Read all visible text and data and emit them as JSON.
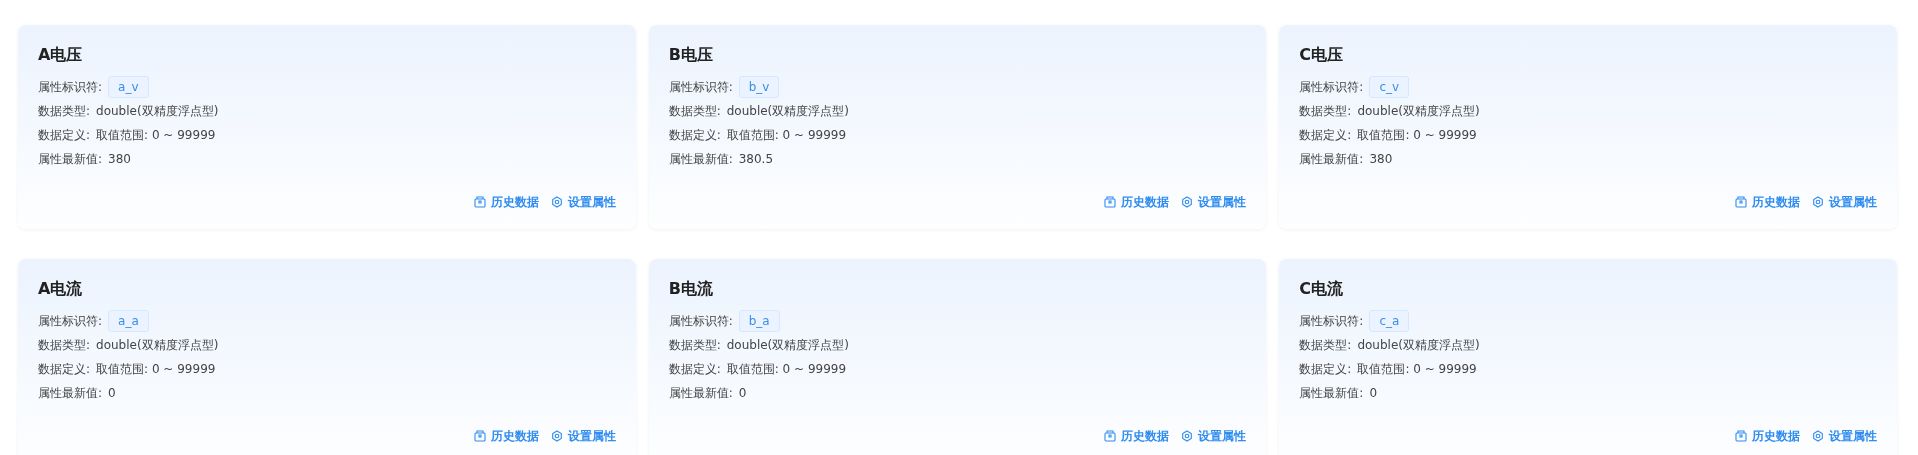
{
  "cards": [
    {
      "title": "A电压",
      "fields": [
        {
          "kind": "tag",
          "label": "属性标识符:",
          "value": "a_v"
        },
        {
          "kind": "text",
          "label": "数据类型:",
          "value": "double(双精度浮点型)"
        },
        {
          "kind": "text",
          "label": "数据定义:",
          "value": "取值范围: 0 ~ 99999"
        },
        {
          "kind": "text",
          "label": "属性最新值:",
          "value": "380"
        }
      ],
      "actions": [
        {
          "kind": "history",
          "label": "历史数据"
        },
        {
          "kind": "settings",
          "label": "设置属性"
        }
      ]
    },
    {
      "title": "B电压",
      "fields": [
        {
          "kind": "tag",
          "label": "属性标识符:",
          "value": "b_v"
        },
        {
          "kind": "text",
          "label": "数据类型:",
          "value": "double(双精度浮点型)"
        },
        {
          "kind": "text",
          "label": "数据定义:",
          "value": "取值范围: 0 ~ 99999"
        },
        {
          "kind": "text",
          "label": "属性最新值:",
          "value": "380.5"
        }
      ],
      "actions": [
        {
          "kind": "history",
          "label": "历史数据"
        },
        {
          "kind": "settings",
          "label": "设置属性"
        }
      ]
    },
    {
      "title": "C电压",
      "fields": [
        {
          "kind": "tag",
          "label": "属性标识符:",
          "value": "c_v"
        },
        {
          "kind": "text",
          "label": "数据类型:",
          "value": "double(双精度浮点型)"
        },
        {
          "kind": "text",
          "label": "数据定义:",
          "value": "取值范围: 0 ~ 99999"
        },
        {
          "kind": "text",
          "label": "属性最新值:",
          "value": "380"
        }
      ],
      "actions": [
        {
          "kind": "history",
          "label": "历史数据"
        },
        {
          "kind": "settings",
          "label": "设置属性"
        }
      ]
    },
    {
      "title": "A电流",
      "fields": [
        {
          "kind": "tag",
          "label": "属性标识符:",
          "value": "a_a"
        },
        {
          "kind": "text",
          "label": "数据类型:",
          "value": "double(双精度浮点型)"
        },
        {
          "kind": "text",
          "label": "数据定义:",
          "value": "取值范围: 0 ~ 99999"
        },
        {
          "kind": "text",
          "label": "属性最新值:",
          "value": "0"
        }
      ],
      "actions": [
        {
          "kind": "history",
          "label": "历史数据"
        },
        {
          "kind": "settings",
          "label": "设置属性"
        }
      ]
    },
    {
      "title": "B电流",
      "fields": [
        {
          "kind": "tag",
          "label": "属性标识符:",
          "value": "b_a"
        },
        {
          "kind": "text",
          "label": "数据类型:",
          "value": "double(双精度浮点型)"
        },
        {
          "kind": "text",
          "label": "数据定义:",
          "value": "取值范围: 0 ~ 99999"
        },
        {
          "kind": "text",
          "label": "属性最新值:",
          "value": "0"
        }
      ],
      "actions": [
        {
          "kind": "history",
          "label": "历史数据"
        },
        {
          "kind": "settings",
          "label": "设置属性"
        }
      ]
    },
    {
      "title": "C电流",
      "fields": [
        {
          "kind": "tag",
          "label": "属性标识符:",
          "value": "c_a"
        },
        {
          "kind": "text",
          "label": "数据类型:",
          "value": "double(双精度浮点型)"
        },
        {
          "kind": "text",
          "label": "数据定义:",
          "value": "取值范围: 0 ~ 99999"
        },
        {
          "kind": "text",
          "label": "属性最新值:",
          "value": "0"
        }
      ],
      "actions": [
        {
          "kind": "history",
          "label": "历史数据"
        },
        {
          "kind": "settings",
          "label": "设置属性"
        }
      ]
    }
  ]
}
